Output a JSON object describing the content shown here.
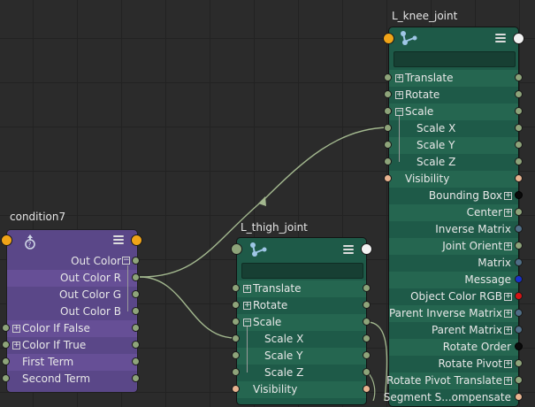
{
  "nodes": {
    "condition": {
      "title": "condition7",
      "attrs": [
        "Out Color",
        "Out Color R",
        "Out Color G",
        "Out Color B",
        "Color If False",
        "Color If True",
        "First Term",
        "Second Term"
      ]
    },
    "thigh": {
      "title": "L_thigh_joint",
      "attrs": [
        "Translate",
        "Rotate",
        "Scale",
        "Scale X",
        "Scale Y",
        "Scale Z",
        "Visibility"
      ]
    },
    "knee": {
      "title": "L_knee_joint",
      "attrs": [
        "Translate",
        "Rotate",
        "Scale",
        "Scale X",
        "Scale Y",
        "Scale Z",
        "Visibility",
        "Bounding Box",
        "Center",
        "Inverse Matrix",
        "Joint Orient",
        "Matrix",
        "Message",
        "Object Color RGB",
        "Parent Inverse Matrix",
        "Parent Matrix",
        "Rotate Order",
        "Rotate Pivot",
        "Rotate Pivot Translate",
        "Segment S...ompensate"
      ]
    }
  },
  "colors": {
    "condition_body": "#5a4788",
    "joint_body": "#1e5a48",
    "wire": "#a2b78e"
  }
}
